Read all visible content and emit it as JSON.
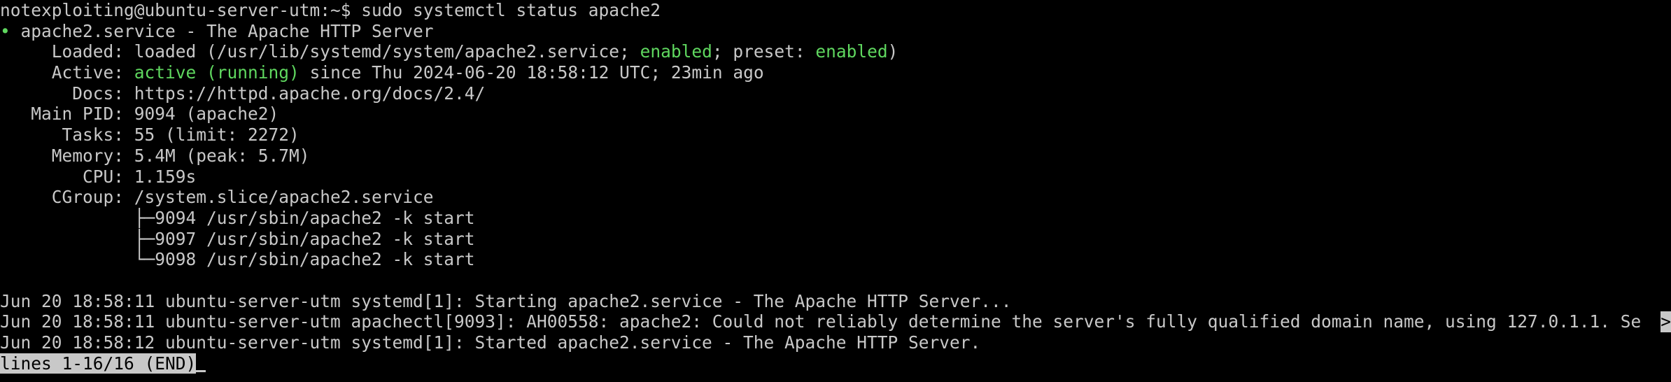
{
  "terminal": {
    "prompt": "notexploiting@ubuntu-server-utm:~$",
    "command": "sudo systemctl status apache2",
    "status_dot": "•",
    "unit_line": "apache2.service - The Apache HTTP Server",
    "loaded": {
      "label": "Loaded:",
      "pre": "loaded (/usr/lib/systemd/system/apache2.service; ",
      "enabled": "enabled",
      "mid": "; preset: ",
      "preset": "enabled",
      "post": ")"
    },
    "active": {
      "label": "Active:",
      "state": "active (running)",
      "rest": " since Thu 2024-06-20 18:58:12 UTC; 23min ago"
    },
    "docs": {
      "label": "Docs:",
      "value": "https://httpd.apache.org/docs/2.4/"
    },
    "main_pid": {
      "label": "Main PID:",
      "value": "9094 (apache2)"
    },
    "tasks": {
      "label": "Tasks:",
      "value": "55 (limit: 2272)"
    },
    "memory": {
      "label": "Memory:",
      "value": "5.4M (peak: 5.7M)"
    },
    "cpu": {
      "label": "CPU:",
      "value": "1.159s"
    },
    "cgroup": {
      "label": "CGroup:",
      "value": "/system.slice/apache2.service"
    },
    "processes": [
      "├─9094 /usr/sbin/apache2 -k start",
      "├─9097 /usr/sbin/apache2 -k start",
      "└─9098 /usr/sbin/apache2 -k start"
    ],
    "journal": [
      "Jun 20 18:58:11 ubuntu-server-utm systemd[1]: Starting apache2.service - The Apache HTTP Server...",
      "Jun 20 18:58:11 ubuntu-server-utm apachectl[9093]: AH00558: apache2: Could not reliably determine the server's fully qualified domain name, using 127.0.1.1. Se",
      "Jun 20 18:58:12 ubuntu-server-utm systemd[1]: Started apache2.service - The Apache HTTP Server."
    ],
    "overflow_marker": ">",
    "pager_status": "lines 1-16/16 (END)"
  }
}
